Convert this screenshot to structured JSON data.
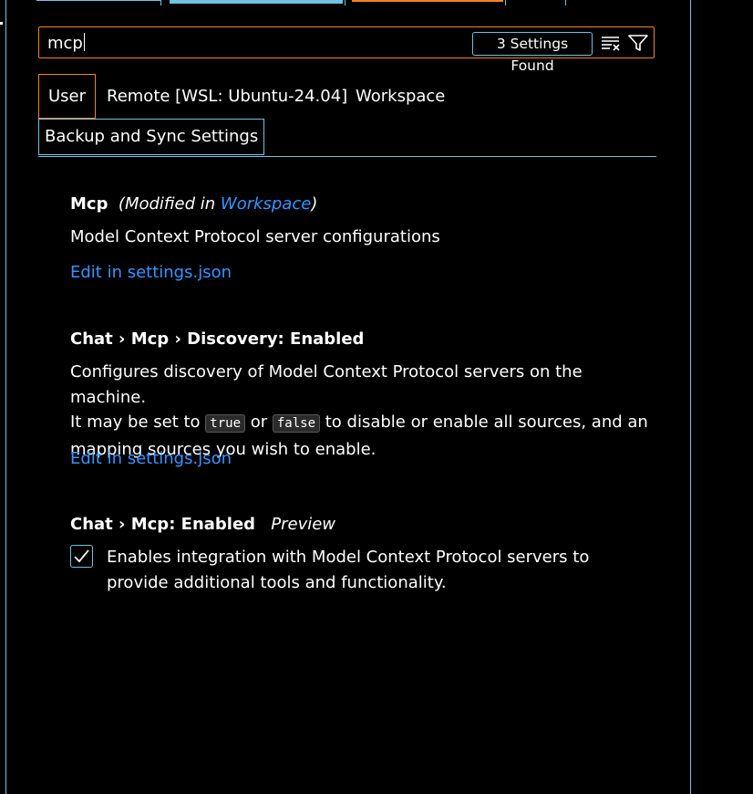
{
  "search": {
    "value": "mcp",
    "results_count": "3 Settings Found",
    "clear_icon": "clear-filter-icon",
    "filter_icon": "filter-icon"
  },
  "scopes": {
    "user": "User",
    "remote": "Remote [WSL: Ubuntu-24.04]",
    "workspace": "Workspace",
    "backup": "Backup and Sync Settings"
  },
  "settings": [
    {
      "title": "Mcp",
      "modified_prefix": "(Modified in ",
      "modified_link": "Workspace",
      "modified_suffix": ")",
      "description": "Model Context Protocol server configurations",
      "edit_link": "Edit in settings.json"
    },
    {
      "title": "Chat › Mcp › Discovery: Enabled",
      "description_line1": "Configures discovery of Model Context Protocol servers on the machine.",
      "description_pre": "It may be set to ",
      "code_true": "true",
      "description_mid": " or ",
      "code_false": "false",
      "description_post": " to disable or enable all sources, and an mapping sources you wish to enable.",
      "edit_link": "Edit in settings.json"
    },
    {
      "title": "Chat › Mcp: Enabled",
      "tag": "Preview",
      "checked": true,
      "checkbox_label": "Enables integration with Model Context Protocol servers to provide additional tools and functionality."
    }
  ],
  "colors": {
    "focus_border": "#f38518",
    "contrast_border": "#6fc3df",
    "link": "#3794ff"
  }
}
